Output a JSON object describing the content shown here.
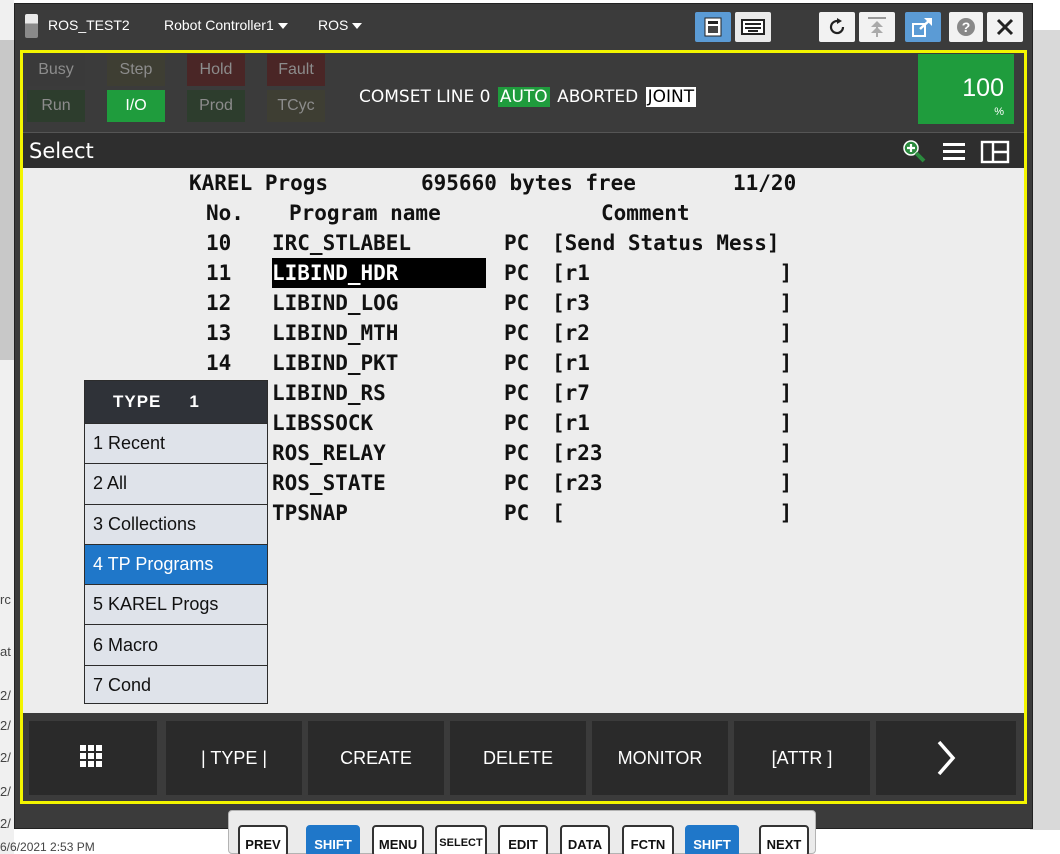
{
  "window": {
    "title": "ROS_TEST2",
    "controller": "Robot Controller1",
    "mode": "ROS"
  },
  "status": {
    "leds": [
      {
        "label": "Busy",
        "on": false
      },
      {
        "label": "Step",
        "on": false
      },
      {
        "label": "Hold",
        "on": false
      },
      {
        "label": "Fault",
        "on": false
      },
      {
        "label": "Run",
        "on": false
      },
      {
        "label": "I/O",
        "on": true
      },
      {
        "label": "Prod",
        "on": false
      },
      {
        "label": "TCyc",
        "on": false
      }
    ],
    "line_text": "COMSET LINE 0",
    "auto": "AUTO",
    "state": "ABORTED",
    "coord": "JOINT",
    "override": "100",
    "override_unit": "%"
  },
  "header": {
    "title": "Select"
  },
  "program_list": {
    "summary": {
      "kind": "KAREL Progs",
      "free": "695660 bytes free",
      "count": "11/20"
    },
    "columns": {
      "no": "No.",
      "name": "Program name",
      "comment": "Comment"
    },
    "rows": [
      {
        "no": "10",
        "name": "IRC_STLABEL",
        "type": "PC",
        "comment": "[Send Status Mess]"
      },
      {
        "no": "11",
        "name": "LIBIND_HDR",
        "type": "PC",
        "comment": "[r1               ]"
      },
      {
        "no": "12",
        "name": "LIBIND_LOG",
        "type": "PC",
        "comment": "[r3               ]"
      },
      {
        "no": "13",
        "name": "LIBIND_MTH",
        "type": "PC",
        "comment": "[r2               ]"
      },
      {
        "no": "14",
        "name": "LIBIND_PKT",
        "type": "PC",
        "comment": "[r1               ]"
      },
      {
        "no": "",
        "name": "LIBIND_RS",
        "type": "PC",
        "comment": "[r7               ]"
      },
      {
        "no": "",
        "name": "LIBSSOCK",
        "type": "PC",
        "comment": "[r1               ]"
      },
      {
        "no": "",
        "name": "ROS_RELAY",
        "type": "PC",
        "comment": "[r23              ]"
      },
      {
        "no": "",
        "name": "ROS_STATE",
        "type": "PC",
        "comment": "[r23              ]"
      },
      {
        "no": "",
        "name": "TPSNAP",
        "type": "PC",
        "comment": "[                 ]"
      }
    ]
  },
  "type_menu": {
    "title": "TYPE",
    "number": "1",
    "items": [
      {
        "label": "1 Recent"
      },
      {
        "label": "2 All"
      },
      {
        "label": "3 Collections"
      },
      {
        "label": "4 TP Programs"
      },
      {
        "label": "5 KAREL Progs"
      },
      {
        "label": "6 Macro"
      },
      {
        "label": "7 Cond"
      }
    ]
  },
  "function_keys": [
    "| TYPE |",
    "CREATE",
    "DELETE",
    "MONITOR",
    "[ATTR ]"
  ],
  "hardware_keys": [
    "PREV",
    "SHIFT",
    "MENU",
    "SELECT",
    "EDIT",
    "DATA",
    "FCTN",
    "SHIFT",
    "NEXT"
  ],
  "background": {
    "left_snippets": [
      "rc",
      "at",
      "2/",
      "2/",
      "2/",
      "2/",
      "2/"
    ],
    "bottom_snippet": "6/6/2021 2:53 PM"
  },
  "colors": {
    "frame": "#3b3b3b",
    "display_border": "#f3f500",
    "led_on": "#1f9c3d",
    "auto": "#1f9c3d",
    "selection": "#1f77c9"
  }
}
